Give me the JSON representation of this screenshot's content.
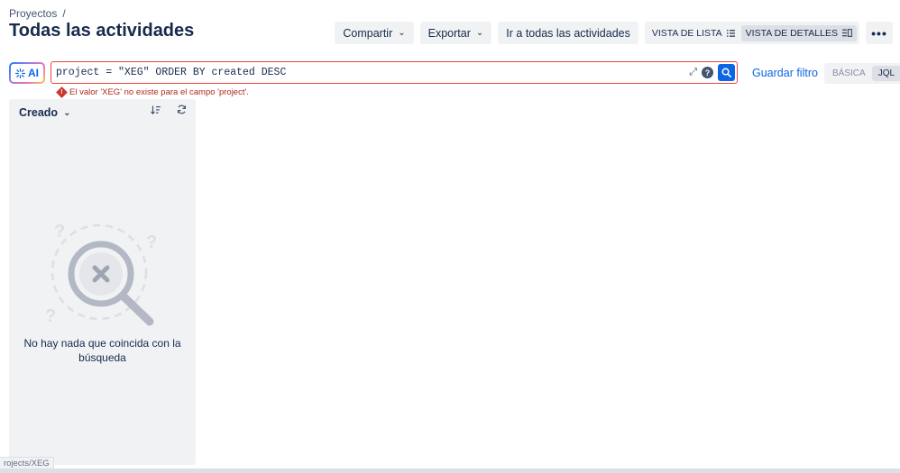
{
  "breadcrumb": {
    "project": "Proyectos",
    "separator": "/"
  },
  "page": {
    "title": "Todas las actividades"
  },
  "toolbar": {
    "share_label": "Compartir",
    "export_label": "Exportar",
    "all_activities_label": "Ir a todas las actividades",
    "list_view_label": "VISTA DE LISTA",
    "detail_view_label": "VISTA DE DETALLES",
    "active_view": "detail"
  },
  "search": {
    "ai_label": "AI",
    "jql_value": "project = \"XEG\" ORDER BY created DESC",
    "save_filter_label": "Guardar filtro",
    "mode_basic": "BÁSICA",
    "mode_jql": "JQL",
    "active_mode": "JQL",
    "error": "El valor 'XEG' no existe para el campo 'project'."
  },
  "panel": {
    "sort_label": "Creado",
    "empty_message": "No hay nada que coincida con la búsqueda"
  },
  "status_bar": {
    "url": "rojects/XEG"
  },
  "icons": [
    "chevron-down-icon",
    "list-icon",
    "detail-view-icon",
    "more-icon",
    "ai-sparkle-icon",
    "expand-icon",
    "help-icon",
    "search-icon",
    "error-icon",
    "sort-icon",
    "refresh-icon",
    "empty-search-illustration"
  ],
  "colors": {
    "accent": "#0c66e4",
    "error": "#c9372c",
    "error_text": "#ae2a19",
    "panel_bg": "#f1f2f4"
  }
}
